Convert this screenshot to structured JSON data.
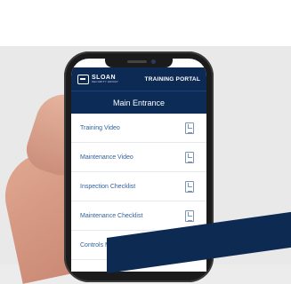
{
  "header": {
    "logo": "SLOAN",
    "logo_sub": "SECURITY GROUP",
    "portal_label": "TRAINING PORTAL"
  },
  "section_title": "Main Entrance",
  "items": [
    {
      "label": "Training Video",
      "icon": "video-file-icon"
    },
    {
      "label": "Maintenance Video",
      "icon": "video-file-icon"
    },
    {
      "label": "Inspection Checklist",
      "icon": "pdf-file-icon"
    },
    {
      "label": "Maintenance Checklist",
      "icon": "pdf-file-icon"
    },
    {
      "label": "Controls Manual",
      "icon": "pdf-file-icon"
    }
  ],
  "colors": {
    "navy": "#0d2a55",
    "link": "#2f5f9a"
  }
}
